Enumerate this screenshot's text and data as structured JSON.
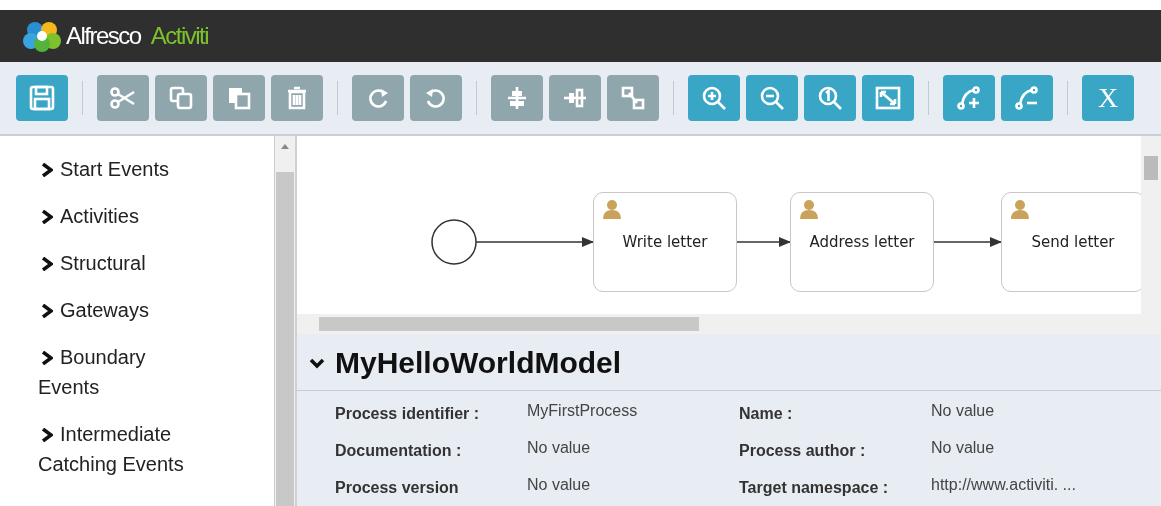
{
  "header": {
    "brand": "Alfresco",
    "product": "Activiti"
  },
  "toolbar": [
    {
      "disabled": false
    },
    {
      "disabled": true
    },
    {
      "disabled": true
    },
    {
      "disabled": true
    },
    {
      "disabled": true
    },
    {
      "disabled": true
    },
    {
      "disabled": true
    },
    {
      "disabled": true
    },
    {
      "disabled": true
    },
    {
      "disabled": true
    },
    {
      "disabled": false
    },
    {
      "disabled": false
    },
    {
      "disabled": false
    },
    {
      "disabled": false
    },
    {
      "disabled": false
    },
    {
      "disabled": false
    },
    {
      "label": "X",
      "disabled": false
    }
  ],
  "palette": [
    {
      "label": "Start Events"
    },
    {
      "label": "Activities"
    },
    {
      "label": "Structural"
    },
    {
      "label": "Gateways"
    },
    {
      "label": "Boundary Events"
    },
    {
      "label": "Intermediate Catching Events"
    }
  ],
  "diagram": {
    "tasks": [
      {
        "label": "Write letter"
      },
      {
        "label": "Address letter"
      },
      {
        "label": "Send letter"
      }
    ]
  },
  "properties": {
    "title": "MyHelloWorldModel",
    "fields": [
      {
        "label": "Process identifier :",
        "value": "MyFirstProcess"
      },
      {
        "label": "Name :",
        "value": "No value"
      },
      {
        "label": "Documentation :",
        "value": "No value"
      },
      {
        "label": "Process author :",
        "value": "No value"
      },
      {
        "label": "Process version",
        "value": "No value"
      },
      {
        "label": "Target namespace :",
        "value": "http://www.activiti. ..."
      }
    ]
  }
}
